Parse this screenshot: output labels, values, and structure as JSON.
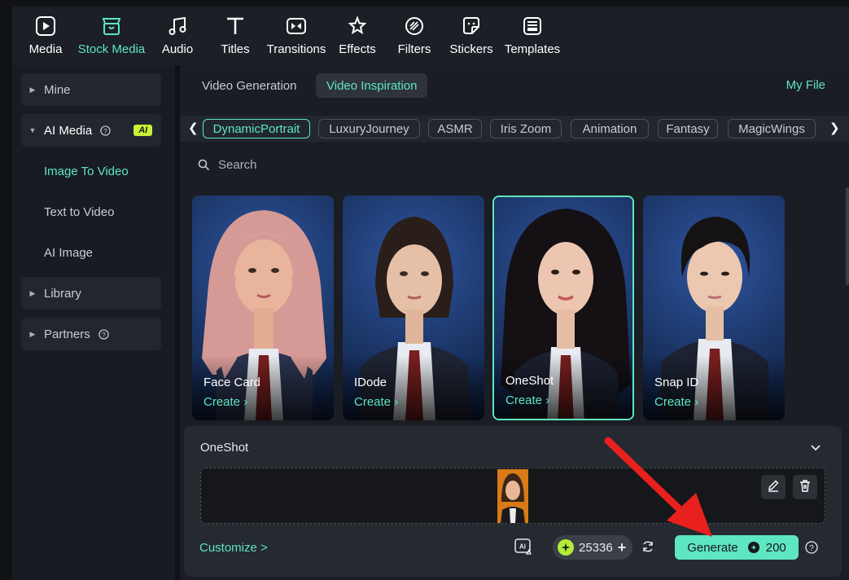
{
  "toolbar": {
    "items": [
      {
        "label": "Media",
        "icon": "media-icon"
      },
      {
        "label": "Stock Media",
        "icon": "stock-media-icon",
        "active": true
      },
      {
        "label": "Audio",
        "icon": "audio-icon"
      },
      {
        "label": "Titles",
        "icon": "titles-icon"
      },
      {
        "label": "Transitions",
        "icon": "transitions-icon"
      },
      {
        "label": "Effects",
        "icon": "effects-icon"
      },
      {
        "label": "Filters",
        "icon": "filters-icon"
      },
      {
        "label": "Stickers",
        "icon": "stickers-icon"
      },
      {
        "label": "Templates",
        "icon": "templates-icon"
      }
    ]
  },
  "sidebar": {
    "mine": "Mine",
    "ai_media": "AI Media",
    "ai_badge": "AI",
    "image_to_video": "Image To Video",
    "text_to_video": "Text to Video",
    "ai_image": "AI Image",
    "library": "Library",
    "partners": "Partners"
  },
  "main": {
    "tabs": [
      {
        "label": "Video Generation"
      },
      {
        "label": "Video Inspiration",
        "active": true
      }
    ],
    "my_file": "My File",
    "chips": [
      "DynamicPortrait",
      "LuxuryJourney",
      "ASMR",
      "Iris Zoom",
      "Animation",
      "Fantasy",
      "MagicWings"
    ],
    "active_chip": "DynamicPortrait",
    "search_placeholder": "Search",
    "cards": [
      {
        "name": "Face Card",
        "action": "Create"
      },
      {
        "name": "IDode",
        "action": "Create"
      },
      {
        "name": "OneShot",
        "action": "Create",
        "selected": true
      },
      {
        "name": "Snap ID",
        "action": "Create"
      }
    ]
  },
  "panel": {
    "title": "OneShot",
    "customize": "Customize >",
    "credits": "25336",
    "generate_label": "Generate",
    "generate_cost": "200"
  },
  "colors": {
    "accent": "#5ee6c0",
    "ai_badge": "#c7f238",
    "annotation_arrow": "#e8201e"
  }
}
